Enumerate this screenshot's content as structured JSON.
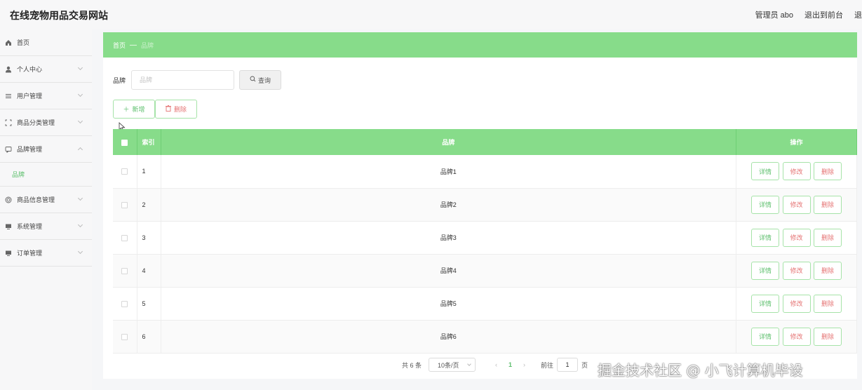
{
  "header": {
    "site_title": "在线宠物用品交易网站",
    "admin_label": "管理员 abo",
    "back_to_front": "退出到前台",
    "logout": "退"
  },
  "sidebar": {
    "items": [
      {
        "label": "首页",
        "icon": "home-icon"
      },
      {
        "label": "个人中心",
        "icon": "user-icon"
      },
      {
        "label": "用户管理",
        "icon": "list-icon"
      },
      {
        "label": "商品分类管理",
        "icon": "expand-icon"
      },
      {
        "label": "品牌管理",
        "icon": "message-icon",
        "expanded": true,
        "children": [
          {
            "label": "品牌"
          }
        ]
      },
      {
        "label": "商品信息管理",
        "icon": "target-icon"
      },
      {
        "label": "系统管理",
        "icon": "monitor-icon"
      },
      {
        "label": "订单管理",
        "icon": "monitor-icon"
      }
    ]
  },
  "breadcrumb": {
    "home": "首页",
    "separator": "—",
    "current": "品牌"
  },
  "search": {
    "label": "品牌",
    "placeholder": "品牌",
    "value": "",
    "button": "查询"
  },
  "actions": {
    "add": "新增",
    "delete": "删除"
  },
  "table": {
    "columns": {
      "index": "索引",
      "name": "品牌",
      "ops": "操作"
    },
    "rows": [
      {
        "index": "1",
        "name": "品牌1"
      },
      {
        "index": "2",
        "name": "品牌2"
      },
      {
        "index": "3",
        "name": "品牌3"
      },
      {
        "index": "4",
        "name": "品牌4"
      },
      {
        "index": "5",
        "name": "品牌5"
      },
      {
        "index": "6",
        "name": "品牌6"
      }
    ],
    "op_labels": {
      "detail": "详情",
      "edit": "修改",
      "delete": "删除"
    }
  },
  "pagination": {
    "total": "共 6 条",
    "page_size": "10条/页",
    "current_page": "1",
    "goto_label": "前往",
    "goto_value": "1",
    "page_suffix": "页"
  },
  "watermark": "掘金技术社区 @ 小飞计算机毕设",
  "colors": {
    "accent": "#87dc8a",
    "accent_text": "#5cbf6c",
    "danger": "#e57373"
  }
}
